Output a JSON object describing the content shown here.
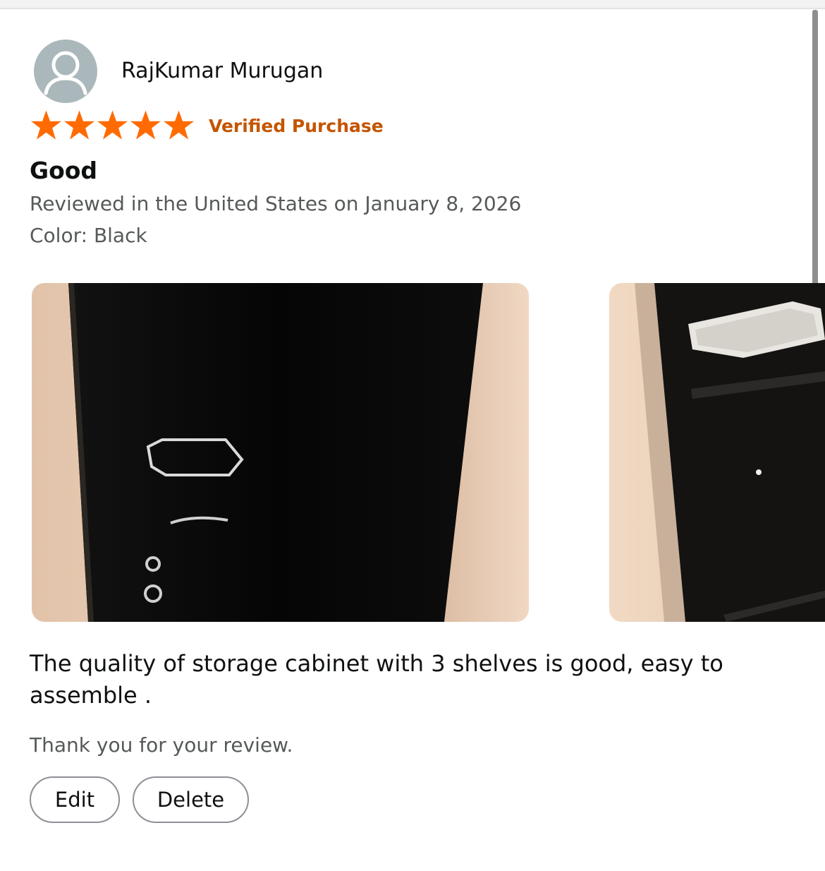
{
  "review": {
    "reviewer_name": "RajKumar Murugan",
    "rating": 5,
    "rating_max": 5,
    "badge": "Verified Purchase",
    "title": "Good",
    "date_line": "Reviewed in the United States on January 8, 2026",
    "variant_line": "Color: Black",
    "body": "The quality of storage cabinet with 3 shelves is good, easy to assemble .",
    "confirmation": "Thank you for your review."
  },
  "actions": {
    "edit_label": "Edit",
    "delete_label": "Delete"
  },
  "colors": {
    "star": "#ff6b00",
    "badge": "#c45500",
    "avatar_bg": "#abb8bb",
    "secondary_text": "#565959",
    "button_border": "#8d9096"
  },
  "icons": {
    "avatar": "person-icon",
    "rating": "star-icon"
  }
}
